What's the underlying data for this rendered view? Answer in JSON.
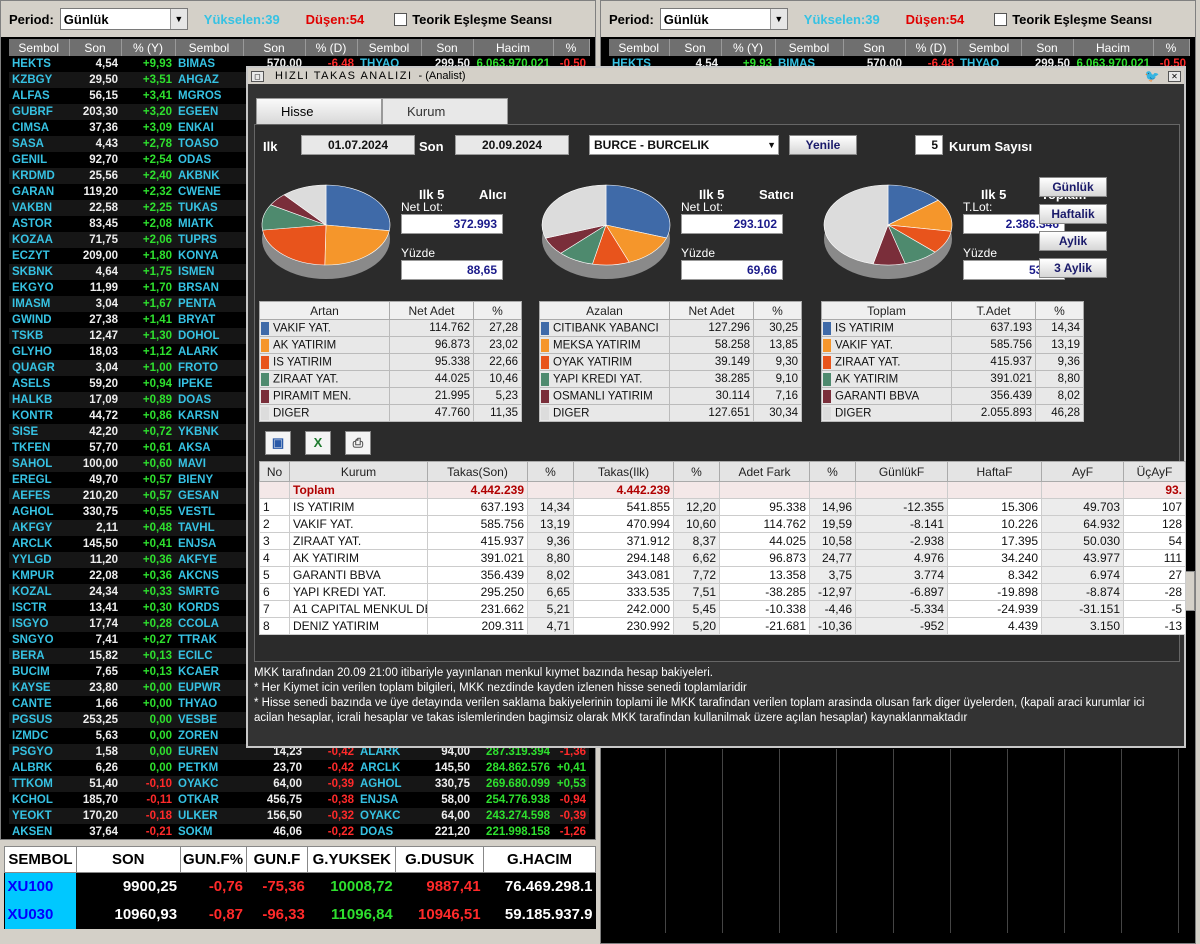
{
  "toolbar": {
    "period_label": "Period:",
    "period_value": "Günlük",
    "rising": "Yükselen:39",
    "falling": "Düşen:54",
    "session_label": "Teorik Eşleşme Seansı"
  },
  "market": {
    "headers": [
      "Sembol",
      "Son",
      "% (Y)",
      "Sembol",
      "Son",
      "% (D)",
      "Sembol",
      "Son",
      "Hacim",
      "%"
    ],
    "rows": [
      [
        "HEKTS",
        "4,54",
        "+9,93",
        "BIMAS",
        "570,00",
        "-6,48",
        "THYAO",
        "299,50",
        "6.063.970.021",
        "-0,50"
      ],
      [
        "KZBGY",
        "29,50",
        "+3,51",
        "AHGAZ",
        "",
        "",
        "",
        "",
        "",
        ""
      ],
      [
        "ALFAS",
        "56,15",
        "+3,41",
        "MGROS",
        "",
        "",
        "",
        "",
        "",
        ""
      ],
      [
        "GUBRF",
        "203,30",
        "+3,20",
        "EGEEN",
        "10",
        "",
        "",
        "",
        "",
        ""
      ],
      [
        "CIMSA",
        "37,36",
        "+3,09",
        "ENKAI",
        "",
        "",
        "",
        "",
        "",
        ""
      ],
      [
        "SASA",
        "4,43",
        "+2,78",
        "TOASO",
        "",
        "",
        "",
        "",
        "",
        ""
      ],
      [
        "GENIL",
        "92,70",
        "+2,54",
        "ODAS",
        "",
        "",
        "",
        "",
        "",
        ""
      ],
      [
        "KRDMD",
        "25,56",
        "+2,40",
        "AKBNK",
        "",
        "",
        "",
        "",
        "",
        ""
      ],
      [
        "GARAN",
        "119,20",
        "+2,32",
        "CWENE",
        "",
        "",
        "",
        "",
        "",
        ""
      ],
      [
        "VAKBN",
        "22,58",
        "+2,25",
        "TUKAS",
        "",
        "",
        "",
        "",
        "",
        ""
      ],
      [
        "ASTOR",
        "83,45",
        "+2,08",
        "MIATK",
        "",
        "",
        "",
        "",
        "",
        ""
      ],
      [
        "KOZAA",
        "71,75",
        "+2,06",
        "TUPRS",
        "",
        "",
        "",
        "",
        "",
        ""
      ],
      [
        "ECZYT",
        "209,00",
        "+1,80",
        "KONYA",
        "6",
        "",
        "",
        "",
        "",
        ""
      ],
      [
        "SKBNK",
        "4,64",
        "+1,75",
        "ISMEN",
        "",
        "",
        "",
        "",
        "",
        ""
      ],
      [
        "EKGYO",
        "11,99",
        "+1,70",
        "BRSAN",
        "",
        "",
        "",
        "",
        "",
        ""
      ],
      [
        "IMASM",
        "3,04",
        "+1,67",
        "PENTA",
        "",
        "",
        "",
        "",
        "",
        ""
      ],
      [
        "GWIND",
        "27,38",
        "+1,41",
        "BRYAT",
        "2",
        "",
        "",
        "",
        "",
        ""
      ],
      [
        "TSKB",
        "12,47",
        "+1,30",
        "DOHOL",
        "",
        "",
        "",
        "",
        "",
        ""
      ],
      [
        "GLYHO",
        "18,03",
        "+1,12",
        "ALARK",
        "",
        "",
        "",
        "",
        "",
        ""
      ],
      [
        "QUAGR",
        "3,04",
        "+1,00",
        "FROTO",
        "",
        "",
        "",
        "",
        "",
        ""
      ],
      [
        "ASELS",
        "59,20",
        "+0,94",
        "IPEKE",
        "",
        "",
        "",
        "",
        "",
        ""
      ],
      [
        "HALKB",
        "17,09",
        "+0,89",
        "DOAS",
        "",
        "",
        "",
        "",
        "",
        ""
      ],
      [
        "KONTR",
        "44,72",
        "+0,86",
        "KARSN",
        "",
        "",
        "",
        "",
        "",
        ""
      ],
      [
        "SISE",
        "42,20",
        "+0,72",
        "YKBNK",
        "",
        "",
        "",
        "",
        "",
        ""
      ],
      [
        "TKFEN",
        "57,70",
        "+0,61",
        "AKSA",
        "",
        "",
        "",
        "",
        "",
        ""
      ],
      [
        "SAHOL",
        "100,00",
        "+0,60",
        "MAVI",
        "",
        "",
        "",
        "",
        "",
        ""
      ],
      [
        "EREGL",
        "49,70",
        "+0,57",
        "BIENY",
        "",
        "",
        "",
        "",
        "",
        ""
      ],
      [
        "AEFES",
        "210,20",
        "+0,57",
        "GESAN",
        "",
        "",
        "",
        "",
        "",
        ""
      ],
      [
        "AGHOL",
        "330,75",
        "+0,55",
        "VESTL",
        "",
        "",
        "",
        "",
        "",
        ""
      ],
      [
        "AKFGY",
        "2,11",
        "+0,48",
        "TAVHL",
        "",
        "",
        "",
        "",
        "",
        ""
      ],
      [
        "ARCLK",
        "145,50",
        "+0,41",
        "ENJSA",
        "",
        "",
        "",
        "",
        "",
        ""
      ],
      [
        "YYLGD",
        "11,20",
        "+0,36",
        "AKFYE",
        "",
        "",
        "",
        "",
        "",
        ""
      ],
      [
        "KMPUR",
        "22,08",
        "+0,36",
        "AKCNS",
        "",
        "",
        "",
        "",
        "",
        ""
      ],
      [
        "KOZAL",
        "24,34",
        "+0,33",
        "SMRTG",
        "",
        "",
        "",
        "",
        "",
        ""
      ],
      [
        "ISCTR",
        "13,41",
        "+0,30",
        "KORDS",
        "",
        "",
        "",
        "",
        "",
        ""
      ],
      [
        "ISGYO",
        "17,74",
        "+0,28",
        "CCOLA",
        "",
        "",
        "",
        "",
        "",
        ""
      ],
      [
        "SNGYO",
        "7,41",
        "+0,27",
        "TTRAK",
        "",
        "",
        "",
        "",
        "",
        ""
      ],
      [
        "BERA",
        "15,82",
        "+0,13",
        "ECILC",
        "",
        "",
        "",
        "",
        "",
        ""
      ],
      [
        "BUCIM",
        "7,65",
        "+0,13",
        "KCAER",
        "",
        "",
        "",
        "",
        "",
        ""
      ],
      [
        "KAYSE",
        "23,80",
        "+0,00",
        "EUPWR",
        "",
        "",
        "",
        "",
        "",
        ""
      ],
      [
        "CANTE",
        "1,66",
        "+0,00",
        "THYAO",
        "",
        "",
        "",
        "",
        "",
        ""
      ],
      [
        "PGSUS",
        "253,25",
        "0,00",
        "VESBE",
        "",
        "",
        "",
        "",
        "",
        ""
      ],
      [
        "IZMDC",
        "5,63",
        "0,00",
        "ZOREN",
        "",
        "",
        "",
        "",
        "",
        ""
      ],
      [
        "PSGYO",
        "1,58",
        "0,00",
        "EUREN",
        "14,23",
        "-0,42",
        "ALARK",
        "94,00",
        "287.319.394",
        "-1,36"
      ],
      [
        "ALBRK",
        "6,26",
        "0,00",
        "PETKM",
        "23,70",
        "-0,42",
        "ARCLK",
        "145,50",
        "284.862.576",
        "+0,41"
      ],
      [
        "TTKOM",
        "51,40",
        "-0,10",
        "OYAKC",
        "64,00",
        "-0,39",
        "AGHOL",
        "330,75",
        "269.680.099",
        "+0,53"
      ],
      [
        "KCHOL",
        "185,70",
        "-0,11",
        "OTKAR",
        "456,75",
        "-0,38",
        "ENJSA",
        "58,00",
        "254.776.938",
        "-0,94"
      ],
      [
        "YEOKT",
        "170,20",
        "-0,18",
        "ULKER",
        "156,50",
        "-0,32",
        "OYAKC",
        "64,00",
        "243.274.598",
        "-0,39"
      ],
      [
        "AKSEN",
        "37,64",
        "-0,21",
        "SOKM",
        "46,06",
        "-0,22",
        "DOAS",
        "221,20",
        "221.998.158",
        "-1,26"
      ]
    ]
  },
  "right_market": {
    "headers": [
      "Sembol",
      "Son",
      "% (Y)",
      "Sembol",
      "Son",
      "% (D)",
      "Sembol",
      "Son",
      "Hacim",
      "%"
    ],
    "row": [
      "HEKTS",
      "4,54",
      "+9,93",
      "BIMAS",
      "570,00",
      "-6,48",
      "THYAO",
      "299,50",
      "6.063.970.021",
      "-0,50"
    ]
  },
  "index": {
    "headers": [
      "SEMBOL",
      "SON",
      "GUN.F%",
      "GUN.F",
      "G.YUKSEK",
      "G.DUSUK",
      "G.HACIM"
    ],
    "rows": [
      [
        "XU100",
        "9900,25",
        "-0,76",
        "-75,36",
        "10008,72",
        "9887,41",
        "76.469.298.1"
      ],
      [
        "XU030",
        "10960,93",
        "-0,87",
        "-96,33",
        "11096,84",
        "10946,51",
        "59.185.937.9"
      ]
    ]
  },
  "dialog": {
    "title": "HIZLI TAKAS ANALIZI",
    "subtitle": "- (Analist)",
    "tab_hisse": "Hisse",
    "tab_kurum": "Kurum",
    "ilk_label": "Ilk",
    "ilk_date": "01.07.2024",
    "son_label": "Son",
    "son_date": "20.09.2024",
    "stock": "BURCE - BURCELIK",
    "refresh": "Yenile",
    "kurum_count": "5",
    "kurum_count_label": "Kurum Sayısı",
    "period_buttons": [
      "Günlük",
      "Haftalik",
      "Aylik",
      "3 Aylik"
    ],
    "panels": [
      {
        "head": "Ilk 5",
        "type": "Alıcı",
        "net_label": "Net Lot:",
        "net": "372.993",
        "pct_label": "Yüzde",
        "pct": "88,65",
        "cols": [
          "Artan",
          "Net Adet",
          "%"
        ],
        "slices": [
          27.28,
          23.02,
          22.66,
          10.46,
          5.23,
          11.35
        ],
        "rows": [
          [
            "VAKIF YAT.",
            "114.762",
            "27,28"
          ],
          [
            "AK YATIRIM",
            "96.873",
            "23,02"
          ],
          [
            "IS YATIRIM",
            "95.338",
            "22,66"
          ],
          [
            "ZIRAAT YAT.",
            "44.025",
            "10,46"
          ],
          [
            "PIRAMIT MEN.",
            "21.995",
            "5,23"
          ],
          [
            "DIGER",
            "47.760",
            "11,35"
          ]
        ]
      },
      {
        "head": "Ilk 5",
        "type": "Satıcı",
        "net_label": "Net Lot:",
        "net": "293.102",
        "pct_label": "Yüzde",
        "pct": "69,66",
        "cols": [
          "Azalan",
          "Net Adet",
          "%"
        ],
        "slices": [
          30.25,
          13.85,
          9.3,
          9.1,
          7.16,
          30.34
        ],
        "rows": [
          [
            "CITIBANK YABANCI",
            "127.296",
            "30,25"
          ],
          [
            "MEKSA YATIRIM",
            "58.258",
            "13,85"
          ],
          [
            "OYAK YATIRIM",
            "39.149",
            "9,30"
          ],
          [
            "YAPI KREDI YAT.",
            "38.285",
            "9,10"
          ],
          [
            "OSMANLI YATIRIM",
            "30.114",
            "7,16"
          ],
          [
            "DIGER",
            "127.651",
            "30,34"
          ]
        ]
      },
      {
        "head": "Ilk 5",
        "type": "Toplam",
        "net_label": "T.Lot:",
        "net": "2.386.346",
        "pct_label": "Yüzde",
        "pct": "53,72",
        "cols": [
          "Toplam",
          "T.Adet",
          "%"
        ],
        "slices": [
          14.34,
          13.19,
          9.36,
          8.8,
          8.02,
          46.28
        ],
        "rows": [
          [
            "IS YATIRIM",
            "637.193",
            "14,34"
          ],
          [
            "VAKIF YAT.",
            "585.756",
            "13,19"
          ],
          [
            "ZIRAAT YAT.",
            "415.937",
            "9,36"
          ],
          [
            "AK YATIRIM",
            "391.021",
            "8,80"
          ],
          [
            "GARANTI BBVA",
            "356.439",
            "8,02"
          ],
          [
            "DIGER",
            "2.055.893",
            "46,28"
          ]
        ]
      }
    ],
    "slice_colors": [
      "#3f6aa8",
      "#f5962b",
      "#e8541c",
      "#4e8a6e",
      "#7a2e3a",
      "#dcdcdc"
    ],
    "table": {
      "cols": [
        "No",
        "Kurum",
        "Takas(Son)",
        "%",
        "Takas(Ilk)",
        "%",
        "Adet Fark",
        "%",
        "GünlükF",
        "HaftaF",
        "AyF",
        "ÜçAyF"
      ],
      "total": [
        "",
        "Toplam",
        "4.442.239",
        "",
        "4.442.239",
        "",
        "",
        "",
        "",
        "",
        "",
        "93."
      ],
      "rows": [
        [
          "1",
          "IS YATIRIM",
          "637.193",
          "14,34",
          "541.855",
          "12,20",
          "95.338",
          "14,96",
          "-12.355",
          "15.306",
          "49.703",
          "107"
        ],
        [
          "2",
          "VAKIF YAT.",
          "585.756",
          "13,19",
          "470.994",
          "10,60",
          "114.762",
          "19,59",
          "-8.141",
          "10.226",
          "64.932",
          "128"
        ],
        [
          "3",
          "ZIRAAT YAT.",
          "415.937",
          "9,36",
          "371.912",
          "8,37",
          "44.025",
          "10,58",
          "-2.938",
          "17.395",
          "50.030",
          "54"
        ],
        [
          "4",
          "AK YATIRIM",
          "391.021",
          "8,80",
          "294.148",
          "6,62",
          "96.873",
          "24,77",
          "4.976",
          "34.240",
          "43.977",
          "111"
        ],
        [
          "5",
          "GARANTI BBVA",
          "356.439",
          "8,02",
          "343.081",
          "7,72",
          "13.358",
          "3,75",
          "3.774",
          "8.342",
          "6.974",
          "27"
        ],
        [
          "6",
          "YAPI KREDI YAT.",
          "295.250",
          "6,65",
          "333.535",
          "7,51",
          "-38.285",
          "-12,97",
          "-6.897",
          "-19.898",
          "-8.874",
          "-28"
        ],
        [
          "7",
          "A1 CAPITAL MENKUL DE",
          "231.662",
          "5,21",
          "242.000",
          "5,45",
          "-10.338",
          "-4,46",
          "-5.334",
          "-24.939",
          "-31.151",
          "-5"
        ],
        [
          "8",
          "DENIZ YATIRIM",
          "209.311",
          "4,71",
          "230.992",
          "5,20",
          "-21.681",
          "-10,36",
          "-952",
          "4.439",
          "3.150",
          "-13"
        ]
      ]
    },
    "notes": [
      "MKK tarafından 20.09 21:00 itibariyle yayınlanan menkul kıymet bazında hesap bakiyeleri.",
      "* Her Kiymet icin verilen toplam bilgileri, MKK nezdinde kayden izlenen hisse senedi toplamlaridir",
      "* Hisse senedi bazında ve üye detayında verilen saklama bakiyelerinin toplami ile MKK tarafindan verilen toplam arasinda olusan fark diger üyelerden, (kapali araci kurumlar ici",
      "acilan hesaplar, icrali hesaplar ve takas islemlerinden bagimsiz olarak MKK tarafindan kullanilmak üzere açılan hesaplar) kaynaklanmaktadır"
    ]
  }
}
